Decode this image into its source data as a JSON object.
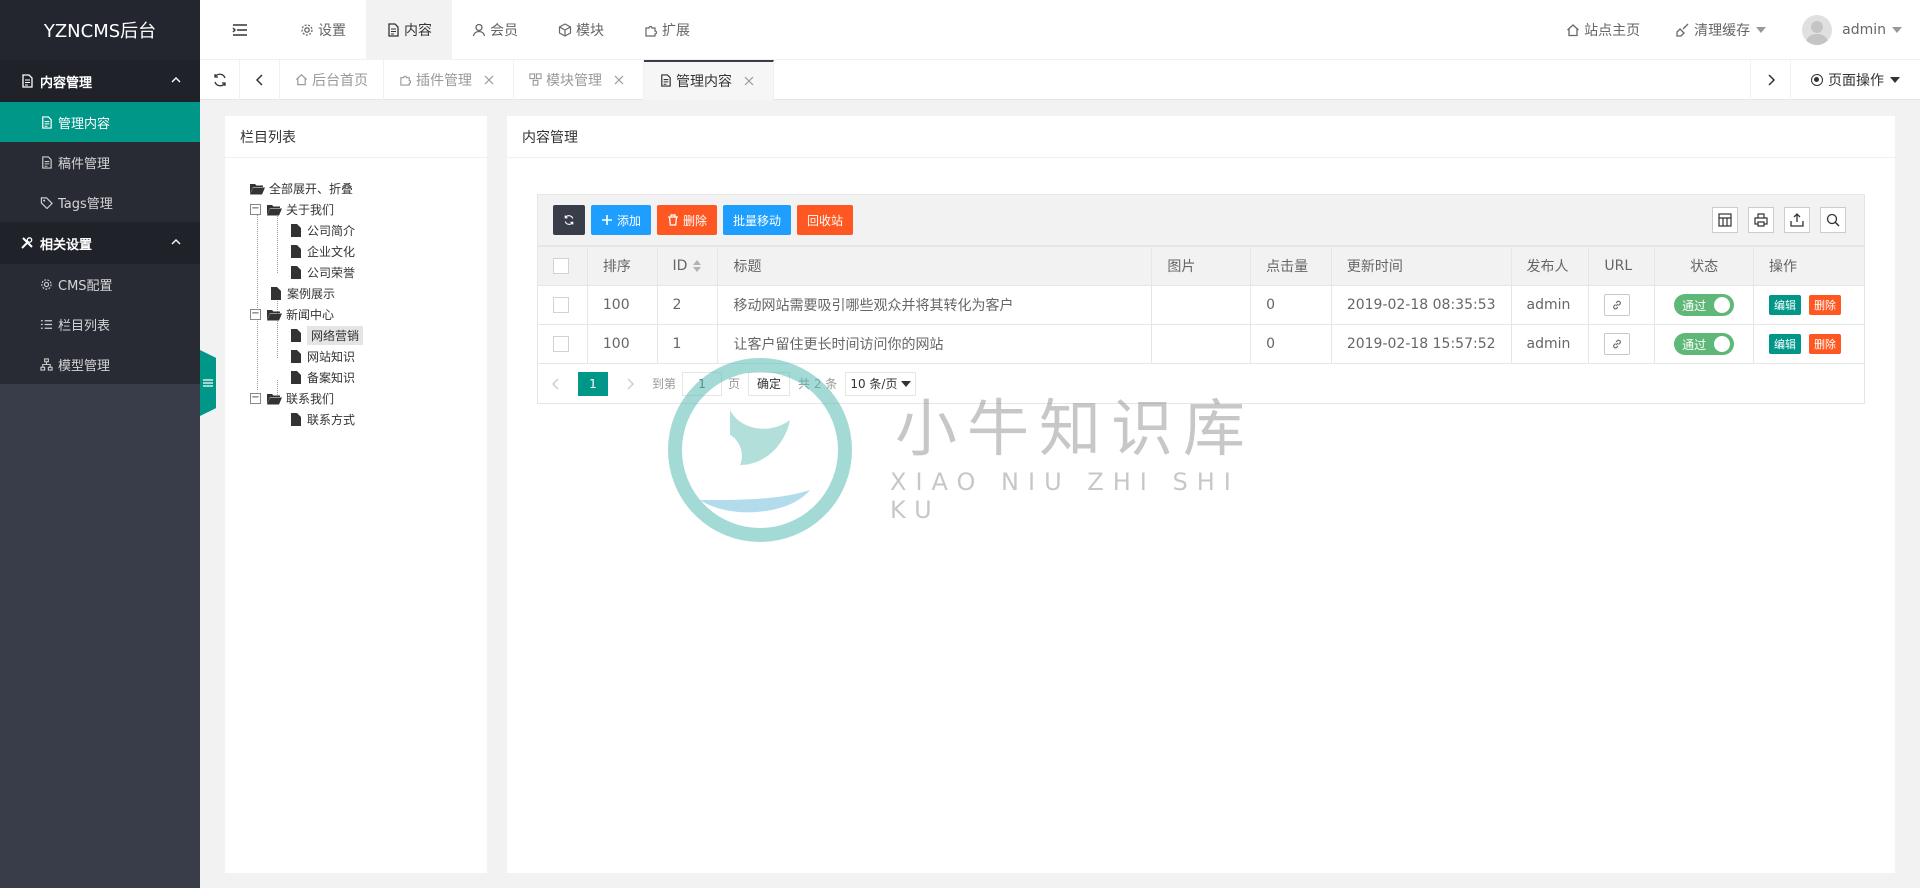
{
  "app": {
    "title": "YZNCMS后台"
  },
  "sidebar": {
    "groups": [
      {
        "label": "内容管理",
        "icon": "document-icon",
        "items": [
          {
            "label": "管理内容",
            "icon": "document-icon",
            "active": true
          },
          {
            "label": "稿件管理",
            "icon": "document-icon"
          },
          {
            "label": "Tags管理",
            "icon": "tag-icon"
          }
        ]
      },
      {
        "label": "相关设置",
        "icon": "tools-icon",
        "items": [
          {
            "label": "CMS配置",
            "icon": "gear-icon"
          },
          {
            "label": "栏目列表",
            "icon": "list-icon"
          },
          {
            "label": "模型管理",
            "icon": "sitemap-icon"
          }
        ]
      }
    ]
  },
  "topnav": {
    "items": [
      {
        "label": "设置",
        "icon": "gear-icon"
      },
      {
        "label": "内容",
        "icon": "document-icon",
        "active": true
      },
      {
        "label": "会员",
        "icon": "user-icon"
      },
      {
        "label": "模块",
        "icon": "cube-icon"
      },
      {
        "label": "扩展",
        "icon": "puzzle-icon"
      }
    ],
    "right": {
      "home": "站点主页",
      "cache": "清理缓存",
      "user": "admin"
    }
  },
  "tabs": {
    "items": [
      {
        "label": "后台首页",
        "icon": "home-icon",
        "closable": false
      },
      {
        "label": "插件管理",
        "icon": "puzzle-icon",
        "closable": true
      },
      {
        "label": "模块管理",
        "icon": "cubes-icon",
        "closable": true
      },
      {
        "label": "管理内容",
        "icon": "document-icon",
        "closable": true,
        "active": true
      }
    ],
    "page_ops": "页面操作"
  },
  "left_panel": {
    "title": "栏目列表",
    "tree": {
      "toggle_all": "全部展开、折叠",
      "nodes": [
        {
          "label": "关于我们",
          "children": [
            "公司简介",
            "企业文化",
            "公司荣誉"
          ]
        },
        {
          "label": "案例展示"
        },
        {
          "label": "新闻中心",
          "children": [
            "网络营销",
            "网站知识",
            "备案知识"
          ],
          "selected_child": "网络营销"
        },
        {
          "label": "联系我们",
          "children": [
            "联系方式"
          ]
        }
      ]
    }
  },
  "main": {
    "title": "内容管理",
    "toolbar": {
      "add": "添加",
      "delete": "删除",
      "batch_move": "批量移动",
      "recycle": "回收站"
    },
    "table": {
      "headers": [
        "排序",
        "ID",
        "标题",
        "图片",
        "点击量",
        "更新时间",
        "发布人",
        "URL",
        "状态",
        "操作"
      ],
      "rows": [
        {
          "order": "100",
          "id": "2",
          "title": "移动网站需要吸引哪些观众并将其转化为客户",
          "image": "",
          "hits": "0",
          "updated": "2019-02-18 08:35:53",
          "author": "admin",
          "status": "通过"
        },
        {
          "order": "100",
          "id": "1",
          "title": "让客户留住更长时间访问你的网站",
          "image": "",
          "hits": "0",
          "updated": "2019-02-18 15:57:52",
          "author": "admin",
          "status": "通过"
        }
      ],
      "row_actions": {
        "edit": "编辑",
        "delete": "删除"
      }
    },
    "pager": {
      "current": "1",
      "goto": "到第",
      "input": "1",
      "page_unit": "页",
      "confirm": "确定",
      "total": "共 2 条",
      "per_page": "10 条/页"
    }
  },
  "watermark": {
    "cn": "小牛知识库",
    "en": "XIAO NIU ZHI SHI KU"
  },
  "colors": {
    "accent": "#009688",
    "sidebar": "#393d49",
    "blue": "#1e9fff",
    "red": "#ff5722",
    "switch_on": "#5fb878"
  }
}
